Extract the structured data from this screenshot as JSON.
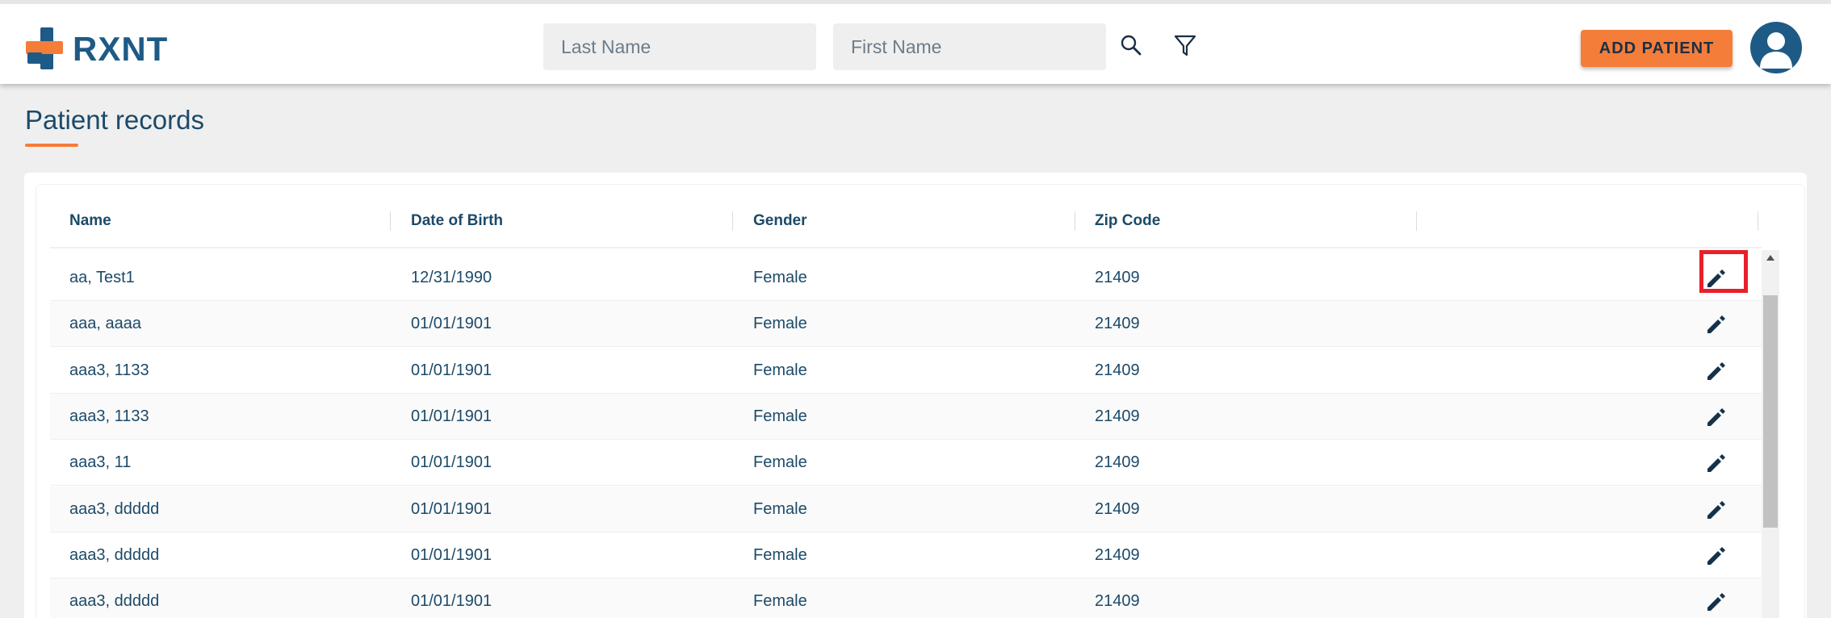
{
  "app": {
    "brand": "RXNT",
    "brand_colors": {
      "navy": "#1e5a86",
      "orange": "#f47d3a"
    }
  },
  "header": {
    "last_name_placeholder": "Last Name",
    "first_name_placeholder": "First Name",
    "search_icon": "search-icon",
    "filter_icon": "filter-icon",
    "add_patient_label": "ADD PATIENT",
    "avatar_icon": "user-avatar-icon"
  },
  "page": {
    "title": "Patient records"
  },
  "table": {
    "columns": [
      "Name",
      "Date of Birth",
      "Gender",
      "Zip Code",
      ""
    ],
    "rows": [
      {
        "name": "aa, Test1",
        "dob": "12/31/1990",
        "gender": "Female",
        "zip": "21409"
      },
      {
        "name": "aaa, aaaa",
        "dob": "01/01/1901",
        "gender": "Female",
        "zip": "21409"
      },
      {
        "name": "aaa3, 1133",
        "dob": "01/01/1901",
        "gender": "Female",
        "zip": "21409"
      },
      {
        "name": "aaa3, 1133",
        "dob": "01/01/1901",
        "gender": "Female",
        "zip": "21409"
      },
      {
        "name": "aaa3, 11",
        "dob": "01/01/1901",
        "gender": "Female",
        "zip": "21409"
      },
      {
        "name": "aaa3, ddddd",
        "dob": "01/01/1901",
        "gender": "Female",
        "zip": "21409"
      },
      {
        "name": "aaa3, ddddd",
        "dob": "01/01/1901",
        "gender": "Female",
        "zip": "21409"
      },
      {
        "name": "aaa3, ddddd",
        "dob": "01/01/1901",
        "gender": "Female",
        "zip": "21409"
      }
    ],
    "row_action_icon": "pencil-edit-icon",
    "highlight_color": "#e8202a"
  }
}
